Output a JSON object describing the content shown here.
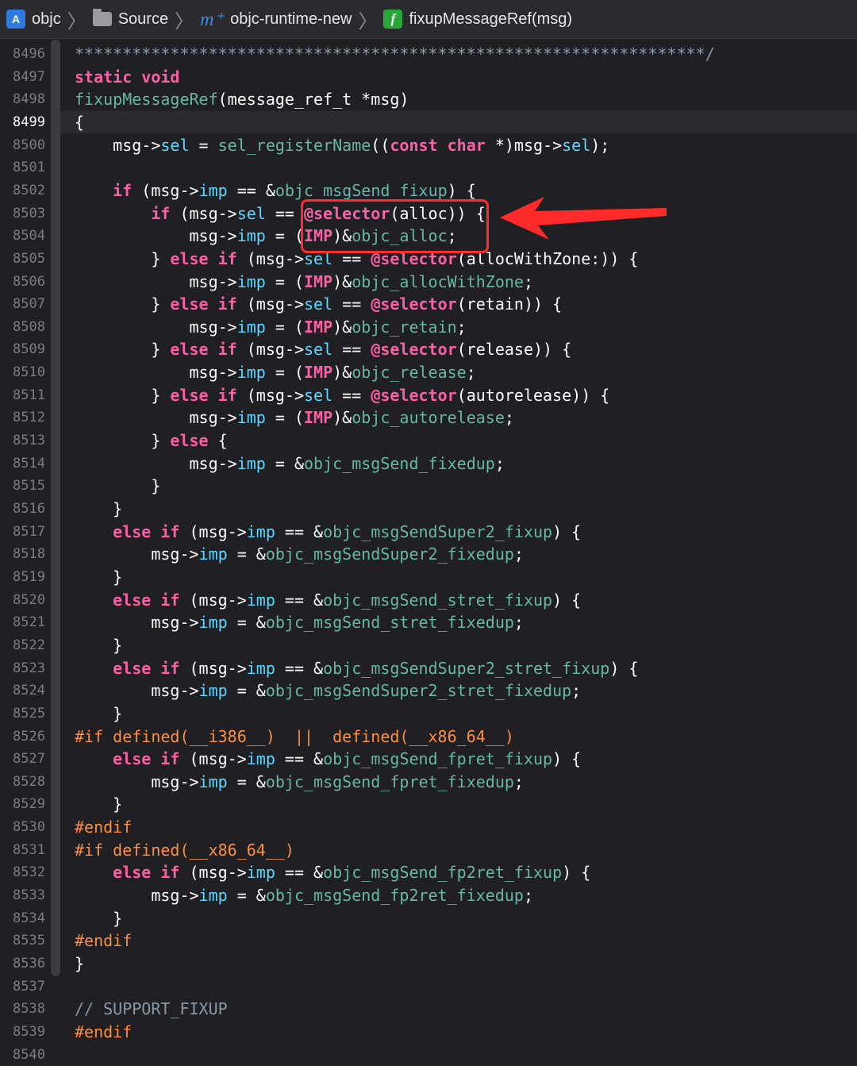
{
  "breadcrumb": [
    {
      "label": "objc",
      "icon": "app-icon"
    },
    {
      "label": "Source",
      "icon": "folder-icon"
    },
    {
      "label": "objc-runtime-new",
      "icon": "objc-file-icon"
    },
    {
      "label": "fixupMessageRef(msg)",
      "icon": "function-icon"
    }
  ],
  "colors": {
    "keyword": "#fc5fa3",
    "function": "#67b7a4",
    "field": "#5dd8ff",
    "preprocessor": "#fd8f3f",
    "comment": "#8a99a6",
    "annotation": "#ff2a2a"
  },
  "current_line": "8499",
  "lines": [
    {
      "n": "8496",
      "t": [
        [
          "st",
          "******************************************************************/"
        ]
      ]
    },
    {
      "n": "8497",
      "t": [
        [
          "kw",
          "static void"
        ]
      ]
    },
    {
      "n": "8498",
      "t": [
        [
          "fn",
          "fixupMessageRef"
        ],
        [
          "pl",
          "(message_ref_t *msg)"
        ]
      ]
    },
    {
      "n": "8499",
      "t": [
        [
          "pl",
          "{"
        ]
      ]
    },
    {
      "n": "8500",
      "t": [
        [
          "pl",
          "    msg->"
        ],
        [
          "fd",
          "sel"
        ],
        [
          "pl",
          " = "
        ],
        [
          "fn",
          "sel_registerName"
        ],
        [
          "pl",
          "(("
        ],
        [
          "kw",
          "const char"
        ],
        [
          "pl",
          " *)msg->"
        ],
        [
          "fd",
          "sel"
        ],
        [
          "pl",
          ");"
        ]
      ]
    },
    {
      "n": "8501",
      "t": []
    },
    {
      "n": "8502",
      "t": [
        [
          "pl",
          "    "
        ],
        [
          "kw",
          "if"
        ],
        [
          "pl",
          " (msg->"
        ],
        [
          "fd",
          "imp"
        ],
        [
          "pl",
          " == &"
        ],
        [
          "fn",
          "objc_msgSend_fixup"
        ],
        [
          "pl",
          ") {"
        ]
      ]
    },
    {
      "n": "8503",
      "t": [
        [
          "pl",
          "        "
        ],
        [
          "kw",
          "if"
        ],
        [
          "pl",
          " (msg->"
        ],
        [
          "fd",
          "sel"
        ],
        [
          "pl",
          " == "
        ],
        [
          "kw",
          "@selector"
        ],
        [
          "pl",
          "(alloc)) {"
        ]
      ]
    },
    {
      "n": "8504",
      "t": [
        [
          "pl",
          "            msg->"
        ],
        [
          "fd",
          "imp"
        ],
        [
          "pl",
          " = ("
        ],
        [
          "kw",
          "IMP"
        ],
        [
          "pl",
          ")&"
        ],
        [
          "fn",
          "objc_alloc"
        ],
        [
          "pl",
          ";"
        ]
      ]
    },
    {
      "n": "8505",
      "t": [
        [
          "pl",
          "        } "
        ],
        [
          "kw",
          "else if"
        ],
        [
          "pl",
          " (msg->"
        ],
        [
          "fd",
          "sel"
        ],
        [
          "pl",
          " == "
        ],
        [
          "kw",
          "@selector"
        ],
        [
          "pl",
          "(allocWithZone:)) {"
        ]
      ]
    },
    {
      "n": "8506",
      "t": [
        [
          "pl",
          "            msg->"
        ],
        [
          "fd",
          "imp"
        ],
        [
          "pl",
          " = ("
        ],
        [
          "kw",
          "IMP"
        ],
        [
          "pl",
          ")&"
        ],
        [
          "fn",
          "objc_allocWithZone"
        ],
        [
          "pl",
          ";"
        ]
      ]
    },
    {
      "n": "8507",
      "t": [
        [
          "pl",
          "        } "
        ],
        [
          "kw",
          "else if"
        ],
        [
          "pl",
          " (msg->"
        ],
        [
          "fd",
          "sel"
        ],
        [
          "pl",
          " == "
        ],
        [
          "kw",
          "@selector"
        ],
        [
          "pl",
          "(retain)) {"
        ]
      ]
    },
    {
      "n": "8508",
      "t": [
        [
          "pl",
          "            msg->"
        ],
        [
          "fd",
          "imp"
        ],
        [
          "pl",
          " = ("
        ],
        [
          "kw",
          "IMP"
        ],
        [
          "pl",
          ")&"
        ],
        [
          "fn",
          "objc_retain"
        ],
        [
          "pl",
          ";"
        ]
      ]
    },
    {
      "n": "8509",
      "t": [
        [
          "pl",
          "        } "
        ],
        [
          "kw",
          "else if"
        ],
        [
          "pl",
          " (msg->"
        ],
        [
          "fd",
          "sel"
        ],
        [
          "pl",
          " == "
        ],
        [
          "kw",
          "@selector"
        ],
        [
          "pl",
          "(release)) {"
        ]
      ]
    },
    {
      "n": "8510",
      "t": [
        [
          "pl",
          "            msg->"
        ],
        [
          "fd",
          "imp"
        ],
        [
          "pl",
          " = ("
        ],
        [
          "kw",
          "IMP"
        ],
        [
          "pl",
          ")&"
        ],
        [
          "fn",
          "objc_release"
        ],
        [
          "pl",
          ";"
        ]
      ]
    },
    {
      "n": "8511",
      "t": [
        [
          "pl",
          "        } "
        ],
        [
          "kw",
          "else if"
        ],
        [
          "pl",
          " (msg->"
        ],
        [
          "fd",
          "sel"
        ],
        [
          "pl",
          " == "
        ],
        [
          "kw",
          "@selector"
        ],
        [
          "pl",
          "(autorelease)) {"
        ]
      ]
    },
    {
      "n": "8512",
      "t": [
        [
          "pl",
          "            msg->"
        ],
        [
          "fd",
          "imp"
        ],
        [
          "pl",
          " = ("
        ],
        [
          "kw",
          "IMP"
        ],
        [
          "pl",
          ")&"
        ],
        [
          "fn",
          "objc_autorelease"
        ],
        [
          "pl",
          ";"
        ]
      ]
    },
    {
      "n": "8513",
      "t": [
        [
          "pl",
          "        } "
        ],
        [
          "kw",
          "else"
        ],
        [
          "pl",
          " {"
        ]
      ]
    },
    {
      "n": "8514",
      "t": [
        [
          "pl",
          "            msg->"
        ],
        [
          "fd",
          "imp"
        ],
        [
          "pl",
          " = &"
        ],
        [
          "fn",
          "objc_msgSend_fixedup"
        ],
        [
          "pl",
          ";"
        ]
      ]
    },
    {
      "n": "8515",
      "t": [
        [
          "pl",
          "        }"
        ]
      ]
    },
    {
      "n": "8516",
      "t": [
        [
          "pl",
          "    }"
        ]
      ]
    },
    {
      "n": "8517",
      "t": [
        [
          "pl",
          "    "
        ],
        [
          "kw",
          "else if"
        ],
        [
          "pl",
          " (msg->"
        ],
        [
          "fd",
          "imp"
        ],
        [
          "pl",
          " == &"
        ],
        [
          "fn",
          "objc_msgSendSuper2_fixup"
        ],
        [
          "pl",
          ") {"
        ]
      ]
    },
    {
      "n": "8518",
      "t": [
        [
          "pl",
          "        msg->"
        ],
        [
          "fd",
          "imp"
        ],
        [
          "pl",
          " = &"
        ],
        [
          "fn",
          "objc_msgSendSuper2_fixedup"
        ],
        [
          "pl",
          ";"
        ]
      ]
    },
    {
      "n": "8519",
      "t": [
        [
          "pl",
          "    }"
        ]
      ]
    },
    {
      "n": "8520",
      "t": [
        [
          "pl",
          "    "
        ],
        [
          "kw",
          "else if"
        ],
        [
          "pl",
          " (msg->"
        ],
        [
          "fd",
          "imp"
        ],
        [
          "pl",
          " == &"
        ],
        [
          "fn",
          "objc_msgSend_stret_fixup"
        ],
        [
          "pl",
          ") {"
        ]
      ]
    },
    {
      "n": "8521",
      "t": [
        [
          "pl",
          "        msg->"
        ],
        [
          "fd",
          "imp"
        ],
        [
          "pl",
          " = &"
        ],
        [
          "fn",
          "objc_msgSend_stret_fixedup"
        ],
        [
          "pl",
          ";"
        ]
      ]
    },
    {
      "n": "8522",
      "t": [
        [
          "pl",
          "    }"
        ]
      ]
    },
    {
      "n": "8523",
      "t": [
        [
          "pl",
          "    "
        ],
        [
          "kw",
          "else if"
        ],
        [
          "pl",
          " (msg->"
        ],
        [
          "fd",
          "imp"
        ],
        [
          "pl",
          " == &"
        ],
        [
          "fn",
          "objc_msgSendSuper2_stret_fixup"
        ],
        [
          "pl",
          ") {"
        ]
      ]
    },
    {
      "n": "8524",
      "t": [
        [
          "pl",
          "        msg->"
        ],
        [
          "fd",
          "imp"
        ],
        [
          "pl",
          " = &"
        ],
        [
          "fn",
          "objc_msgSendSuper2_stret_fixedup"
        ],
        [
          "pl",
          ";"
        ]
      ]
    },
    {
      "n": "8525",
      "t": [
        [
          "pl",
          "    }"
        ]
      ]
    },
    {
      "n": "8526",
      "t": [
        [
          "pp",
          "#if defined(__i386__)  ||  defined(__x86_64__)"
        ]
      ]
    },
    {
      "n": "8527",
      "t": [
        [
          "pl",
          "    "
        ],
        [
          "kw",
          "else if"
        ],
        [
          "pl",
          " (msg->"
        ],
        [
          "fd",
          "imp"
        ],
        [
          "pl",
          " == &"
        ],
        [
          "fn",
          "objc_msgSend_fpret_fixup"
        ],
        [
          "pl",
          ") {"
        ]
      ]
    },
    {
      "n": "8528",
      "t": [
        [
          "pl",
          "        msg->"
        ],
        [
          "fd",
          "imp"
        ],
        [
          "pl",
          " = &"
        ],
        [
          "fn",
          "objc_msgSend_fpret_fixedup"
        ],
        [
          "pl",
          ";"
        ]
      ]
    },
    {
      "n": "8529",
      "t": [
        [
          "pl",
          "    }"
        ]
      ]
    },
    {
      "n": "8530",
      "t": [
        [
          "pp",
          "#endif"
        ]
      ]
    },
    {
      "n": "8531",
      "t": [
        [
          "pp",
          "#if defined(__x86_64__)"
        ]
      ]
    },
    {
      "n": "8532",
      "t": [
        [
          "pl",
          "    "
        ],
        [
          "kw",
          "else if"
        ],
        [
          "pl",
          " (msg->"
        ],
        [
          "fd",
          "imp"
        ],
        [
          "pl",
          " == &"
        ],
        [
          "fn",
          "objc_msgSend_fp2ret_fixup"
        ],
        [
          "pl",
          ") {"
        ]
      ]
    },
    {
      "n": "8533",
      "t": [
        [
          "pl",
          "        msg->"
        ],
        [
          "fd",
          "imp"
        ],
        [
          "pl",
          " = &"
        ],
        [
          "fn",
          "objc_msgSend_fp2ret_fixedup"
        ],
        [
          "pl",
          ";"
        ]
      ]
    },
    {
      "n": "8534",
      "t": [
        [
          "pl",
          "    }"
        ]
      ]
    },
    {
      "n": "8535",
      "t": [
        [
          "pp",
          "#endif"
        ]
      ]
    },
    {
      "n": "8536",
      "t": [
        [
          "pl",
          "}"
        ]
      ]
    },
    {
      "n": "8537",
      "t": []
    },
    {
      "n": "8538",
      "t": [
        [
          "cm",
          "// SUPPORT_FIXUP"
        ]
      ]
    },
    {
      "n": "8539",
      "t": [
        [
          "pp",
          "#endif"
        ]
      ]
    },
    {
      "n": "8540",
      "t": []
    }
  ]
}
